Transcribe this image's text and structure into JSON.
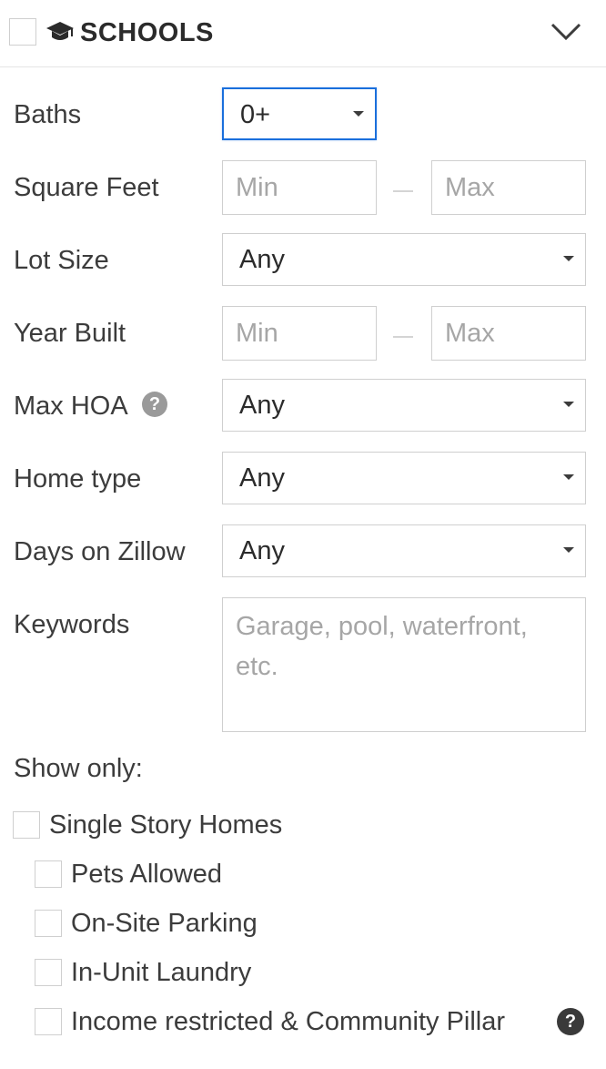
{
  "header": {
    "title": "SCHOOLS",
    "icon": "graduation-cap-icon",
    "expand_icon": "chevron-down-icon"
  },
  "filters": {
    "baths": {
      "label": "Baths",
      "value": "0+"
    },
    "square_feet": {
      "label": "Square Feet",
      "min_placeholder": "Min",
      "max_placeholder": "Max"
    },
    "lot_size": {
      "label": "Lot Size",
      "value": "Any"
    },
    "year_built": {
      "label": "Year Built",
      "min_placeholder": "Min",
      "max_placeholder": "Max"
    },
    "max_hoa": {
      "label": "Max HOA",
      "value": "Any",
      "help": "?"
    },
    "home_type": {
      "label": "Home type",
      "value": "Any"
    },
    "days_on_zillow": {
      "label": "Days on Zillow",
      "value": "Any"
    },
    "keywords": {
      "label": "Keywords",
      "placeholder": "Garage, pool, waterfront, etc."
    }
  },
  "show_only": {
    "label": "Show only:",
    "options": [
      {
        "label": "Single Story Homes",
        "checked": false
      },
      {
        "label": "Pets Allowed",
        "checked": false
      },
      {
        "label": "On-Site Parking",
        "checked": false
      },
      {
        "label": "In-Unit Laundry",
        "checked": false
      },
      {
        "label": "Income restricted & Community Pillar",
        "checked": false
      }
    ],
    "help": "?"
  },
  "colors": {
    "focus": "#1a6fdc",
    "border": "#cfcfcf",
    "text": "#3c3c3c",
    "placeholder": "#a6a6a6",
    "help_light": "#9a9a9a",
    "help_dark": "#3a3a3a"
  }
}
